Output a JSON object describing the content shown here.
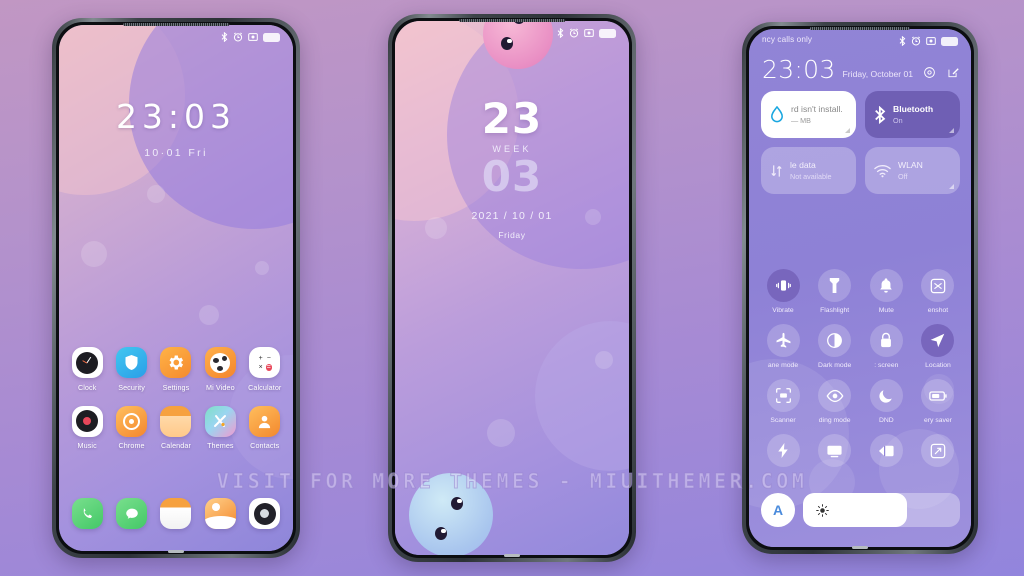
{
  "background": {
    "top_color": "#c197c3",
    "bottom_color": "#9285dd"
  },
  "watermark": {
    "text": "VISIT FOR MORE THEMES - MIUITHEMER.COM"
  },
  "phone1": {
    "status_icons": [
      "bluetooth-icon",
      "alarm-icon",
      "screenshot-icon",
      "battery-icon"
    ],
    "lockscreen": {
      "time": "23:03",
      "date": "10·01  Fri"
    },
    "apps_row1": [
      {
        "label": "Clock",
        "icon": "clock-icon"
      },
      {
        "label": "Security",
        "icon": "shield-icon"
      },
      {
        "label": "Settings",
        "icon": "gear-icon"
      },
      {
        "label": "Mi Video",
        "icon": "video-icon"
      },
      {
        "label": "Calculator",
        "icon": "calculator-icon"
      }
    ],
    "apps_row2": [
      {
        "label": "Music",
        "icon": "music-icon"
      },
      {
        "label": "Chrome",
        "icon": "chrome-icon"
      },
      {
        "label": "Calendar",
        "icon": "calendar-icon"
      },
      {
        "label": "Themes",
        "icon": "themes-icon"
      },
      {
        "label": "Contacts",
        "icon": "contacts-icon"
      }
    ],
    "dock": [
      {
        "label": "Phone",
        "icon": "phone-icon"
      },
      {
        "label": "Messaging",
        "icon": "message-icon"
      },
      {
        "label": "Browser",
        "icon": "browser-icon"
      },
      {
        "label": "Gallery",
        "icon": "gallery-icon"
      },
      {
        "label": "Camera",
        "icon": "camera-icon"
      }
    ]
  },
  "phone2": {
    "status_icons": [
      "bluetooth-icon",
      "alarm-icon",
      "screenshot-icon",
      "battery-icon"
    ],
    "lockscreen": {
      "hour": "23",
      "week_label": "WEEK",
      "minute": "03",
      "date": "2021 / 10 / 01",
      "weekday": "Friday"
    }
  },
  "phone3": {
    "carrier_text": "ncy calls only",
    "status_icons": [
      "bluetooth-icon",
      "alarm-icon",
      "screenshot-icon",
      "battery-icon"
    ],
    "clock": {
      "time": "23:03",
      "date": "Friday, October 01"
    },
    "header_actions": [
      "settings-gear-icon",
      "edit-icon"
    ],
    "tiles": [
      {
        "name": "rd isn't install.",
        "sub": "— MB",
        "state": "white",
        "icon": "water-drop-icon"
      },
      {
        "name": "Bluetooth",
        "sub": "On",
        "state": "dark",
        "icon": "bluetooth-icon"
      },
      {
        "name": "le data",
        "sub": "Not available",
        "state": "off",
        "icon": "mobile-data-icon"
      },
      {
        "name": "WLAN",
        "sub": "Off",
        "state": "off",
        "icon": "wifi-icon"
      }
    ],
    "toggles": [
      {
        "label": "Vibrate",
        "icon": "vibrate-icon",
        "active": true
      },
      {
        "label": "Flashlight",
        "icon": "flashlight-icon",
        "active": false
      },
      {
        "label": "Mute",
        "icon": "bell-icon",
        "active": false
      },
      {
        "label": "enshot",
        "icon": "screenshot-icon",
        "active": false
      },
      {
        "label": "ane mode",
        "icon": "airplane-icon",
        "active": false
      },
      {
        "label": "Dark mode",
        "icon": "dark-mode-icon",
        "active": false
      },
      {
        "label": ": screen",
        "icon": "lock-icon",
        "active": false
      },
      {
        "label": "Location",
        "icon": "location-arrow-icon",
        "active": true
      },
      {
        "label": "Scanner",
        "icon": "scanner-icon",
        "active": false
      },
      {
        "label": "ding mode",
        "icon": "eye-icon",
        "active": false
      },
      {
        "label": "DND",
        "icon": "moon-icon",
        "active": false
      },
      {
        "label": "ery saver",
        "icon": "battery-saver-icon",
        "active": false
      },
      {
        "label": "",
        "icon": "lightning-icon",
        "active": false
      },
      {
        "label": "",
        "icon": "cast-icon",
        "active": false
      },
      {
        "label": "",
        "icon": "data-saver-icon",
        "active": false
      },
      {
        "label": "",
        "icon": "expand-icon",
        "active": false
      }
    ],
    "brightness": {
      "auto_label": "A",
      "level_percent": 66,
      "icon": "sun-icon"
    }
  }
}
